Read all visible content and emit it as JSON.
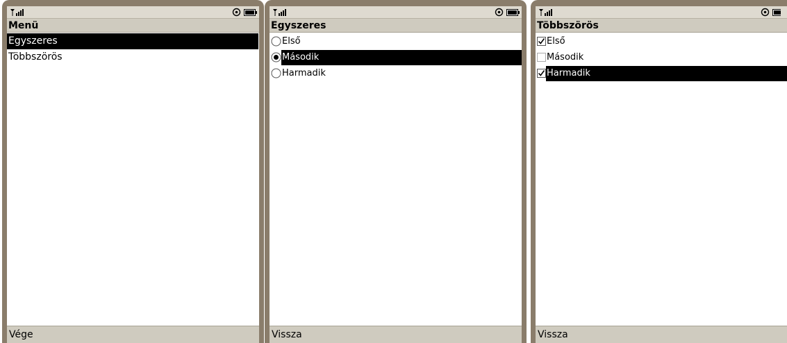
{
  "screens": [
    {
      "title": "Menü",
      "items": [
        "Egyszeres",
        "Többszörös"
      ],
      "soft_key": "Vége"
    },
    {
      "title": "Egyszeres",
      "items": [
        "Első",
        "Második",
        "Harmadik"
      ],
      "soft_key": "Vissza"
    },
    {
      "title": "Többszörös",
      "items": [
        "Első",
        "Második",
        "Harmadik"
      ],
      "soft_key": "Vissza"
    }
  ],
  "states": {
    "menu_selected": "Egyszeres",
    "radio_selected": "Második",
    "checked": [
      "Első",
      "Harmadik"
    ]
  },
  "colors": {
    "frame": "#8a7d6b",
    "selection": "#000000"
  },
  "icons": [
    "signal-icon",
    "settings-icon",
    "battery-icon",
    "radio-icon",
    "checkbox-icon"
  ]
}
